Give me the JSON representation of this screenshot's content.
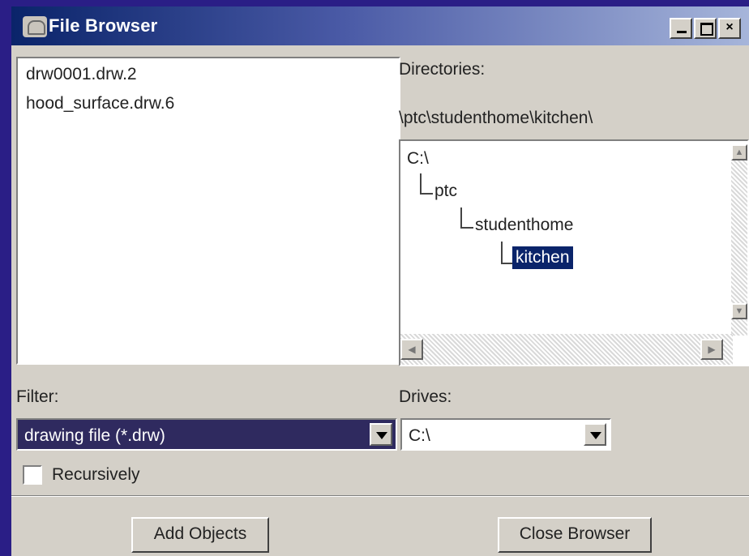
{
  "window": {
    "title": "File Browser",
    "controls": {
      "minimize": "_",
      "maximize": "□",
      "close": "×"
    }
  },
  "files": {
    "items": [
      "drw0001.drw.2",
      "hood_surface.drw.6"
    ]
  },
  "directories": {
    "label": "Directories:",
    "current_path": "\\ptc\\studenthome\\kitchen\\",
    "tree": [
      "C:\\",
      "ptc",
      "studenthome",
      "kitchen"
    ],
    "selected": "kitchen"
  },
  "filter": {
    "label": "Filter:",
    "value": "drawing file (*.drw)"
  },
  "drives": {
    "label": "Drives:",
    "value": "C:\\"
  },
  "recursive": {
    "label": "Recursively",
    "checked": false
  },
  "buttons": {
    "add": "Add Objects",
    "close": "Close Browser"
  },
  "icons": [
    "file-browser-app-icon",
    "minimize-icon",
    "maximize-icon",
    "close-icon",
    "scroll-up-icon",
    "scroll-down-icon",
    "scroll-left-icon",
    "scroll-right-icon",
    "dropdown-arrow-icon"
  ],
  "colors": {
    "desktop": "#2a1e86",
    "titlebar_start": "#0a246a",
    "window_face": "#d4d0c8",
    "selection": "#0a246a"
  }
}
